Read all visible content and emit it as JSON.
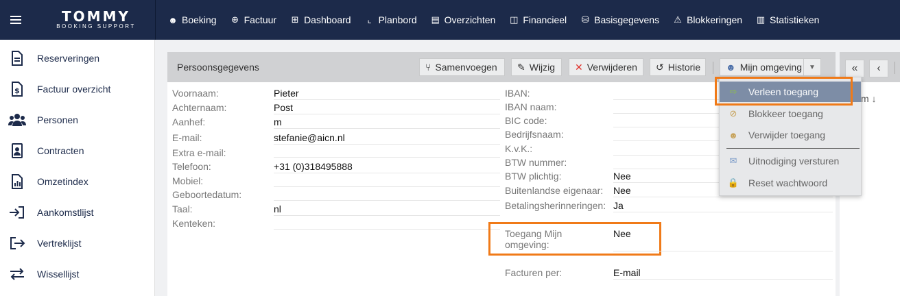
{
  "app": {
    "logo_brand": "TOMMY",
    "logo_sub": "BOOKING SUPPORT"
  },
  "topnav": [
    {
      "label": "Boeking",
      "icon": "smiley-icon",
      "glyph": "☻"
    },
    {
      "label": "Factuur",
      "icon": "plus-circle-icon",
      "glyph": "⊕"
    },
    {
      "label": "Dashboard",
      "icon": "grid-icon",
      "glyph": "⊞"
    },
    {
      "label": "Planbord",
      "icon": "chart-line-icon",
      "glyph": "⌞"
    },
    {
      "label": "Overzichten",
      "icon": "list-icon",
      "glyph": "▤"
    },
    {
      "label": "Financieel",
      "icon": "columns-icon",
      "glyph": "◫"
    },
    {
      "label": "Basisgegevens",
      "icon": "database-icon",
      "glyph": "⛁"
    },
    {
      "label": "Blokkeringen",
      "icon": "warning-icon",
      "glyph": "⚠"
    },
    {
      "label": "Statistieken",
      "icon": "bar-chart-icon",
      "glyph": "▥"
    }
  ],
  "sidebar": [
    {
      "label": "Reserveringen",
      "icon": "document-icon",
      "glyph": "🗎"
    },
    {
      "label": "Factuur overzicht",
      "icon": "invoice-icon",
      "glyph": "$"
    },
    {
      "label": "Personen",
      "icon": "users-icon",
      "glyph": "⚇"
    },
    {
      "label": "Contracten",
      "icon": "contract-icon",
      "glyph": "⚿"
    },
    {
      "label": "Omzetindex",
      "icon": "report-icon",
      "glyph": "▦"
    },
    {
      "label": "Aankomstlijst",
      "icon": "sign-in-icon",
      "glyph": "⇥"
    },
    {
      "label": "Vertreklijst",
      "icon": "sign-out-icon",
      "glyph": "↦"
    },
    {
      "label": "Wissellijst",
      "icon": "exchange-icon",
      "glyph": "⇄"
    }
  ],
  "panel": {
    "title": "Persoonsgegevens",
    "buttons": {
      "merge": "Samenvoegen",
      "edit": "Wijzig",
      "delete": "Verwijderen",
      "history": "Historie",
      "myenv": "Mijn omgeving"
    }
  },
  "left_fields": [
    {
      "label": "Voornaam:",
      "value": "Pieter"
    },
    {
      "label": "Achternaam:",
      "value": "Post"
    },
    {
      "label": "Aanhef:",
      "value": "m"
    },
    {
      "label": "E-mail:",
      "value": "stefanie@aicn.nl"
    },
    {
      "label": "Extra e-mail:",
      "value": ""
    },
    {
      "label": "Telefoon:",
      "value": "+31 (0)318495888"
    },
    {
      "label": "Mobiel:",
      "value": ""
    },
    {
      "label": "Geboortedatum:",
      "value": ""
    },
    {
      "label": "Taal:",
      "value": "nl"
    },
    {
      "label": "Kenteken:",
      "value": ""
    }
  ],
  "right_fields": [
    {
      "label": "IBAN:",
      "value": ""
    },
    {
      "label": "IBAN naam:",
      "value": ""
    },
    {
      "label": "BIC code:",
      "value": ""
    },
    {
      "label": "Bedrijfsnaam:",
      "value": ""
    },
    {
      "label": "K.v.K.:",
      "value": ""
    },
    {
      "label": "BTW nummer:",
      "value": ""
    },
    {
      "label": "BTW plichtig:",
      "value": "Nee"
    },
    {
      "label": "Buitenlandse eigenaar:",
      "value": "Nee"
    },
    {
      "label": "Betalingsherinneringen:",
      "value": "Ja"
    }
  ],
  "access": {
    "label_line1": "Toegang Mijn",
    "label_line2": "omgeving:",
    "value": "Nee"
  },
  "invoices": {
    "label": "Facturen per:",
    "value": "E-mail"
  },
  "dropdown": {
    "items": [
      {
        "label": "Verleen toegang",
        "icon": "grant-access-icon",
        "glyph": "⇨"
      },
      {
        "label": "Blokkeer toegang",
        "icon": "block-access-icon",
        "glyph": "⊘"
      },
      {
        "label": "Verwijder toegang",
        "icon": "remove-access-icon",
        "glyph": "☻"
      },
      {
        "label": "Uitnodiging versturen",
        "icon": "send-invite-icon",
        "glyph": "✉"
      },
      {
        "label": "Reset wachtwoord",
        "icon": "reset-password-icon",
        "glyph": "🔒"
      }
    ]
  },
  "right_panel": {
    "sort_text": "m"
  },
  "colors": {
    "topbar": "#1c2a4a",
    "highlight": "#f07a18",
    "active_item": "#7d8da6"
  }
}
